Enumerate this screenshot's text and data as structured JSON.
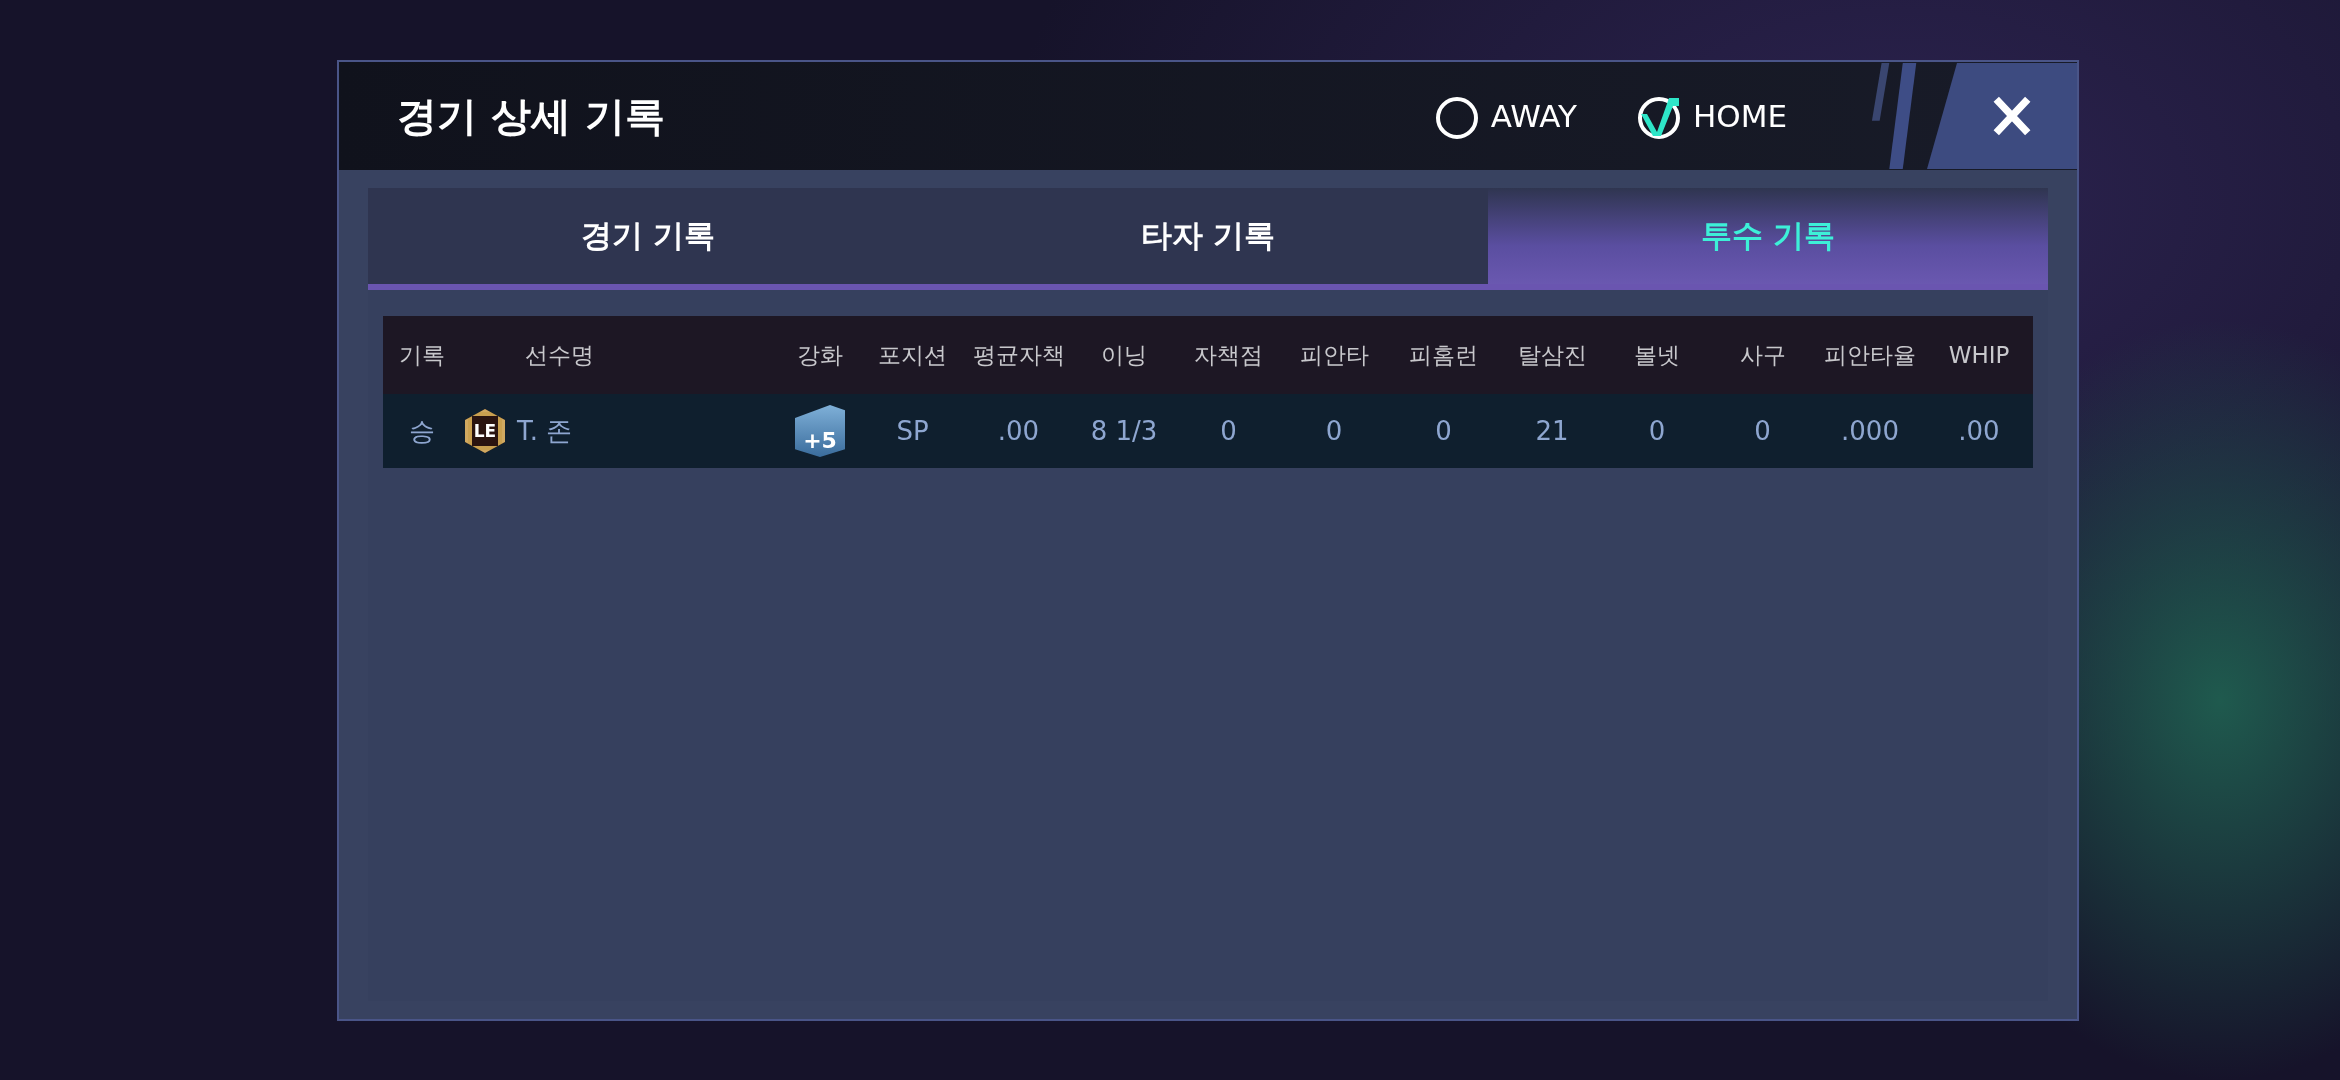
{
  "dialog": {
    "title": "경기 상세 기록"
  },
  "team_toggle": [
    {
      "label": "AWAY",
      "selected": false
    },
    {
      "label": "HOME",
      "selected": true
    }
  ],
  "tabs": [
    {
      "label": "경기 기록",
      "selected": false
    },
    {
      "label": "타자 기록",
      "selected": false
    },
    {
      "label": "투수 기록",
      "selected": true
    }
  ],
  "table": {
    "columns": [
      "기록",
      "선수명",
      "강화",
      "포지션",
      "평균자책",
      "이닝",
      "자책점",
      "피안타",
      "피홈런",
      "탈삼진",
      "볼넷",
      "사구",
      "피안타율",
      "WHIP"
    ],
    "rows": [
      {
        "result": "승",
        "grade": "LE",
        "name": "T. 존",
        "enhance": "+5",
        "stats": [
          "SP",
          ".00",
          "8 1/3",
          "0",
          "0",
          "0",
          "21",
          "0",
          "0",
          ".000",
          ".00"
        ]
      }
    ]
  }
}
